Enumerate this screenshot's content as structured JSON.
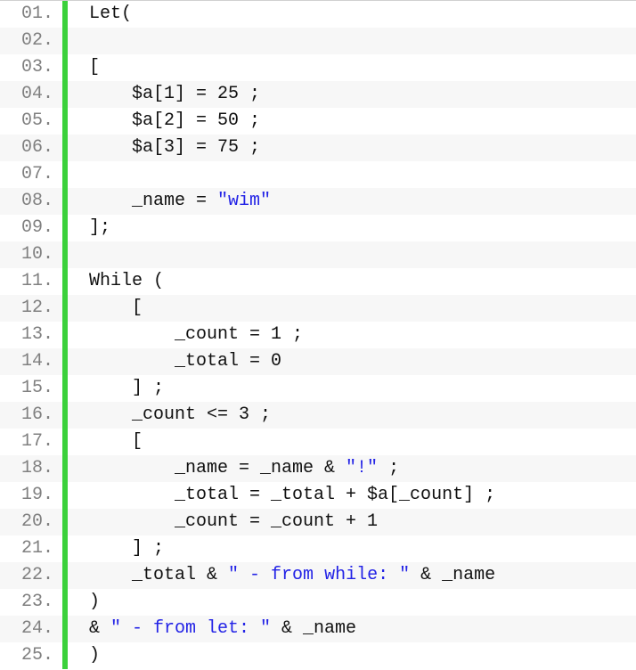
{
  "colors": {
    "gutter_text": "#808080",
    "marker": "#3bd13b",
    "stripe": "#f7f7f7",
    "code_default": "#111111",
    "string": "#2323e6"
  },
  "lines": [
    {
      "number": "01.",
      "indent": 0,
      "tokens": [
        {
          "text": "Let(",
          "cls": "t-default"
        }
      ]
    },
    {
      "number": "02.",
      "indent": 0,
      "tokens": []
    },
    {
      "number": "03.",
      "indent": 0,
      "tokens": [
        {
          "text": "[",
          "cls": "t-default"
        }
      ]
    },
    {
      "number": "04.",
      "indent": 4,
      "tokens": [
        {
          "text": "$a[1] = 25 ;",
          "cls": "t-default"
        }
      ]
    },
    {
      "number": "05.",
      "indent": 4,
      "tokens": [
        {
          "text": "$a[2] = 50 ;",
          "cls": "t-default"
        }
      ]
    },
    {
      "number": "06.",
      "indent": 4,
      "tokens": [
        {
          "text": "$a[3] = 75 ;",
          "cls": "t-default"
        }
      ]
    },
    {
      "number": "07.",
      "indent": 0,
      "tokens": []
    },
    {
      "number": "08.",
      "indent": 4,
      "tokens": [
        {
          "text": "_name = ",
          "cls": "t-default"
        },
        {
          "text": "\"wim\"",
          "cls": "t-string"
        }
      ]
    },
    {
      "number": "09.",
      "indent": 0,
      "tokens": [
        {
          "text": "];",
          "cls": "t-default"
        }
      ]
    },
    {
      "number": "10.",
      "indent": 0,
      "tokens": []
    },
    {
      "number": "11.",
      "indent": 0,
      "tokens": [
        {
          "text": "While (",
          "cls": "t-default"
        }
      ]
    },
    {
      "number": "12.",
      "indent": 4,
      "tokens": [
        {
          "text": "[",
          "cls": "t-default"
        }
      ]
    },
    {
      "number": "13.",
      "indent": 8,
      "tokens": [
        {
          "text": "_count = 1 ;",
          "cls": "t-default"
        }
      ]
    },
    {
      "number": "14.",
      "indent": 8,
      "tokens": [
        {
          "text": "_total = 0",
          "cls": "t-default"
        }
      ]
    },
    {
      "number": "15.",
      "indent": 4,
      "tokens": [
        {
          "text": "] ;",
          "cls": "t-default"
        }
      ]
    },
    {
      "number": "16.",
      "indent": 4,
      "tokens": [
        {
          "text": "_count <= 3 ;",
          "cls": "t-default"
        }
      ]
    },
    {
      "number": "17.",
      "indent": 4,
      "tokens": [
        {
          "text": "[",
          "cls": "t-default"
        }
      ]
    },
    {
      "number": "18.",
      "indent": 8,
      "tokens": [
        {
          "text": "_name = _name & ",
          "cls": "t-default"
        },
        {
          "text": "\"!\"",
          "cls": "t-string"
        },
        {
          "text": " ;",
          "cls": "t-default"
        }
      ]
    },
    {
      "number": "19.",
      "indent": 8,
      "tokens": [
        {
          "text": "_total = _total + $a[_count] ;",
          "cls": "t-default"
        }
      ]
    },
    {
      "number": "20.",
      "indent": 8,
      "tokens": [
        {
          "text": "_count = _count + 1",
          "cls": "t-default"
        }
      ]
    },
    {
      "number": "21.",
      "indent": 4,
      "tokens": [
        {
          "text": "] ;",
          "cls": "t-default"
        }
      ]
    },
    {
      "number": "22.",
      "indent": 4,
      "tokens": [
        {
          "text": "_total & ",
          "cls": "t-default"
        },
        {
          "text": "\" - from while: \"",
          "cls": "t-string"
        },
        {
          "text": " & _name",
          "cls": "t-default"
        }
      ]
    },
    {
      "number": "23.",
      "indent": 0,
      "tokens": [
        {
          "text": ")",
          "cls": "t-default"
        }
      ]
    },
    {
      "number": "24.",
      "indent": 0,
      "tokens": [
        {
          "text": "& ",
          "cls": "t-default"
        },
        {
          "text": "\" - from let: \"",
          "cls": "t-string"
        },
        {
          "text": " & _name",
          "cls": "t-default"
        }
      ]
    },
    {
      "number": "25.",
      "indent": 0,
      "tokens": [
        {
          "text": ")",
          "cls": "t-default"
        }
      ]
    }
  ]
}
